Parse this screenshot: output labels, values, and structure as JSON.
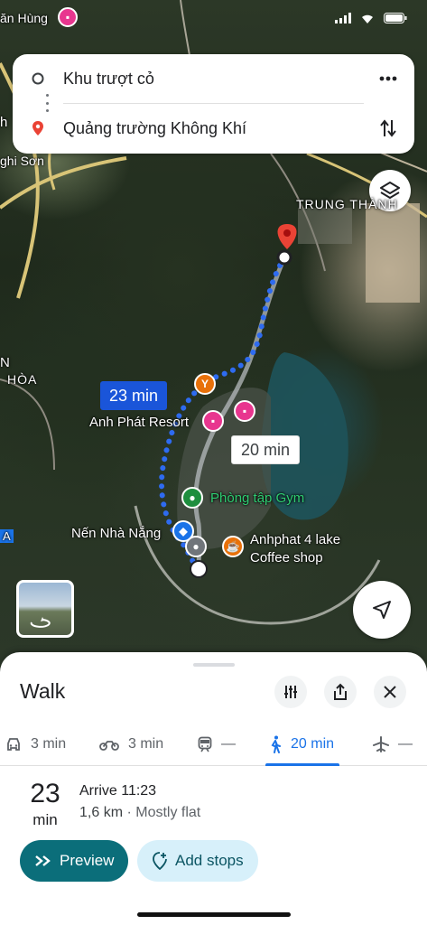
{
  "status_bar": {
    "time": ""
  },
  "route": {
    "origin": "Khu trượt cỏ",
    "destination": "Quảng trường Không Khí"
  },
  "map": {
    "labels": {
      "trung_thanh": "TRUNG THÀNH",
      "anh_phat_resort": "Anh Phát Resort",
      "gym": "Phòng tập Gym",
      "nen_nha_nang": "Nến Nhà Nắng",
      "coffee_shop_line1": "Anhphat 4 lake",
      "coffee_shop_line2": "Coffee shop",
      "hoa": "HÒA",
      "nghi_son": "ghi Sơn",
      "an_hung": "ăn Hùng",
      "edge_h": "h",
      "edge_n": "N",
      "edge_a": "A"
    },
    "selected_route_duration": "23 min",
    "alt_route_duration": "20 min",
    "colors": {
      "route": "#2e6bf0",
      "pin": "#ea4335",
      "gym_poi": "#1e8e3e",
      "hotel_poi": "#e8368f",
      "cafe_poi": "#e8710a"
    }
  },
  "sheet": {
    "title": "Walk",
    "modes": [
      {
        "icon": "car-icon",
        "label": "3 min"
      },
      {
        "icon": "motorbike-icon",
        "label": "3 min"
      },
      {
        "icon": "transit-icon",
        "label": "—"
      },
      {
        "icon": "walk-icon",
        "label": "20 min",
        "active": true
      },
      {
        "icon": "plane-icon",
        "label": "—"
      }
    ],
    "summary": {
      "duration_num": "23",
      "duration_unit": "min",
      "arrive": "Arrive 11:23",
      "distance": "1,6 km",
      "terrain": " · Mostly flat"
    },
    "buttons": {
      "preview": "Preview",
      "add_stops": "Add stops"
    }
  }
}
